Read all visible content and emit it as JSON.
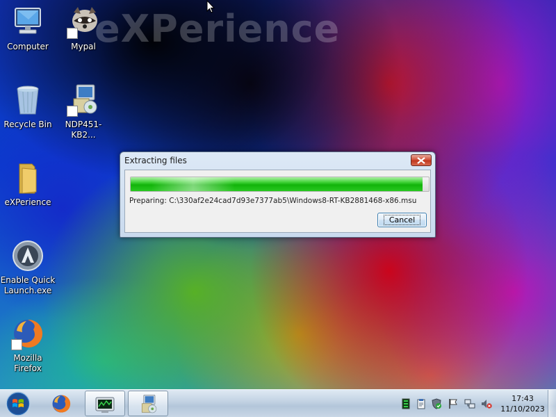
{
  "desktop": {
    "watermark": "eXPerience",
    "icons": [
      {
        "label": "Computer",
        "icon": "computer-icon"
      },
      {
        "label": "Mypal",
        "icon": "mypal-icon"
      },
      {
        "label": "Recycle Bin",
        "icon": "recycle-bin-icon"
      },
      {
        "label": "NDP451-KB2...",
        "icon": "installer-icon"
      },
      {
        "label": "eXPerience",
        "icon": "folder-icon"
      },
      {
        "label": "Enable Quick Launch.exe",
        "icon": "launcher-icon"
      },
      {
        "label": "Mozilla Firefox",
        "icon": "firefox-icon"
      }
    ]
  },
  "dialog": {
    "title": "Extracting files",
    "progress": 0.98,
    "status": "Preparing: C:\\330af2e24cad7d93e7377ab5\\Windows8-RT-KB2881468-x86.msu",
    "cancel_label": "Cancel"
  },
  "taskbar": {
    "items": [
      {
        "icon": "windows-start-icon"
      },
      {
        "icon": "firefox-icon"
      },
      {
        "icon": "task-manager-icon"
      },
      {
        "icon": "installer-icon"
      }
    ],
    "tray": [
      "green-bar-icon",
      "clipboard-icon",
      "shield-icon",
      "flag-icon",
      "network-icon",
      "speaker-mute-icon"
    ],
    "time": "17:43",
    "date": "11/10/2023"
  },
  "colors": {
    "progress_green": "#12b40a",
    "close_red": "#c0381f",
    "taskbar": "#c4d4e4"
  }
}
